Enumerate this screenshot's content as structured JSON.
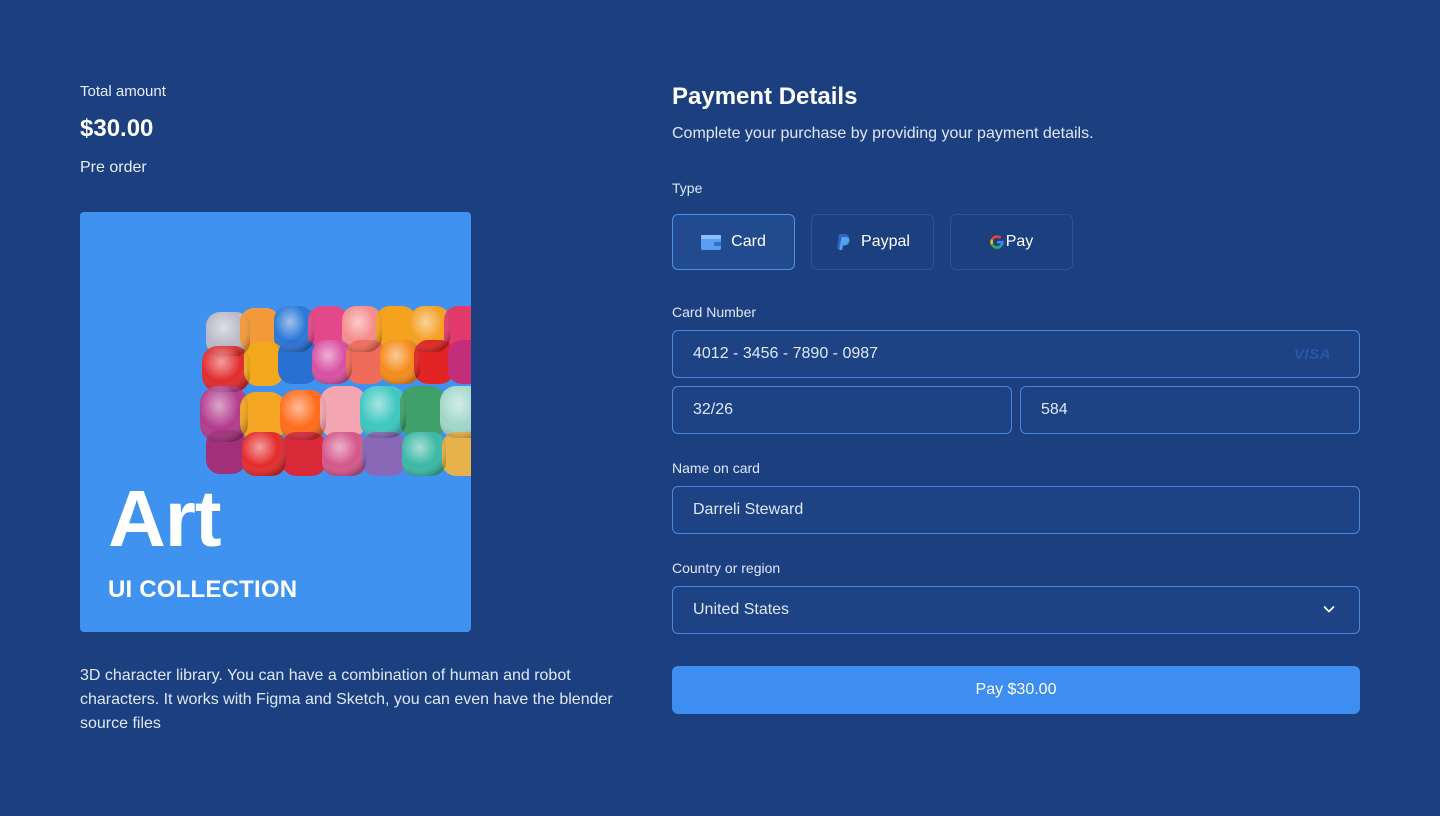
{
  "summary": {
    "total_label": "Total amount",
    "total_value": "$30.00",
    "status": "Pre order"
  },
  "product": {
    "title": "Art",
    "subtitle": "UI COLLECTION",
    "image_icon": "puffy-sofa-image",
    "description": "3D character library. You can have a combination of human and robot characters. It works with Figma and Sketch, you can even have the blender source files"
  },
  "payment": {
    "title": "Payment Details",
    "subtitle": "Complete your purchase by providing your payment details.",
    "type_label": "Type",
    "types": [
      {
        "label": "Card",
        "icon": "wallet-icon",
        "selected": true
      },
      {
        "label": "Paypal",
        "icon": "paypal-icon",
        "selected": false
      },
      {
        "label": "Pay",
        "icon": "google-icon",
        "selected": false
      }
    ],
    "card_number_label": "Card Number",
    "card_number": "4012 - 3456 - 7890 - 0987",
    "card_brand": "VISA",
    "expiry": "32/26",
    "cvc": "584",
    "name_label": "Name on card",
    "name": "Darreli Steward",
    "country_label": "Country or region",
    "country": "United States",
    "pay_label": "Pay $30.00"
  },
  "colors": {
    "background": "#1b3f7f",
    "accent": "#3d8ef0",
    "card_bg": "#4092f0"
  }
}
